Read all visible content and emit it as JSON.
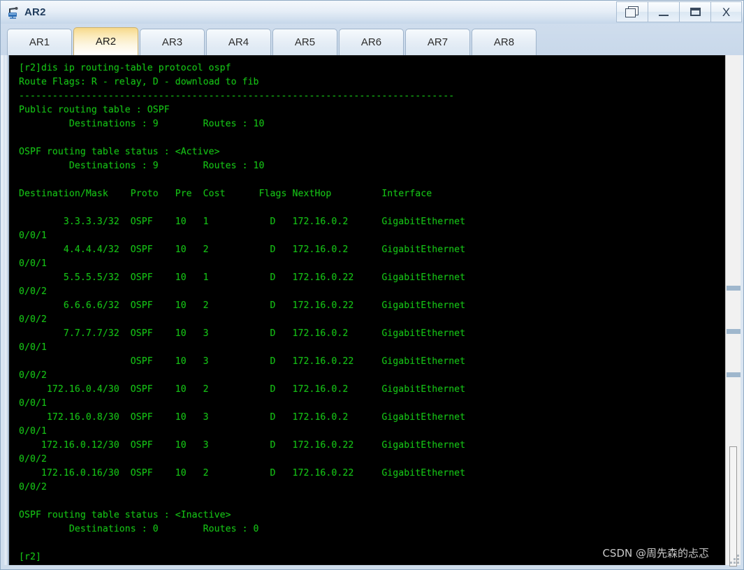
{
  "window": {
    "title": "AR2",
    "icon": "router-icon",
    "controls": [
      {
        "name": "restore-windows-button",
        "label": ""
      },
      {
        "name": "minimize-button",
        "label": ""
      },
      {
        "name": "maximize-button",
        "label": ""
      },
      {
        "name": "close-button",
        "label": "X"
      }
    ]
  },
  "tabs": [
    {
      "label": "AR1",
      "active": false
    },
    {
      "label": "AR2",
      "active": true
    },
    {
      "label": "AR3",
      "active": false
    },
    {
      "label": "AR4",
      "active": false
    },
    {
      "label": "AR5",
      "active": false
    },
    {
      "label": "AR6",
      "active": false
    },
    {
      "label": "AR7",
      "active": false
    },
    {
      "label": "AR8",
      "active": false
    }
  ],
  "terminal": {
    "prompt": "[r2]",
    "command": "dis ip routing-table protocol ospf",
    "colors": {
      "background": "#000000",
      "text": "#15bf15"
    },
    "lines": [
      "[r2]dis ip routing-table protocol ospf",
      "Route Flags: R - relay, D - download to fib",
      "------------------------------------------------------------------------------",
      "Public routing table : OSPF",
      "         Destinations : 9        Routes : 10",
      "",
      "OSPF routing table status : <Active>",
      "         Destinations : 9        Routes : 10",
      "",
      "Destination/Mask    Proto   Pre  Cost      Flags NextHop         Interface",
      "",
      "        3.3.3.3/32  OSPF    10   1           D   172.16.0.2      GigabitEthernet",
      "0/0/1",
      "        4.4.4.4/32  OSPF    10   2           D   172.16.0.2      GigabitEthernet",
      "0/0/1",
      "        5.5.5.5/32  OSPF    10   1           D   172.16.0.22     GigabitEthernet",
      "0/0/2",
      "        6.6.6.6/32  OSPF    10   2           D   172.16.0.22     GigabitEthernet",
      "0/0/2",
      "        7.7.7.7/32  OSPF    10   3           D   172.16.0.2      GigabitEthernet",
      "0/0/1",
      "                    OSPF    10   3           D   172.16.0.22     GigabitEthernet",
      "0/0/2",
      "     172.16.0.4/30  OSPF    10   2           D   172.16.0.2      GigabitEthernet",
      "0/0/1",
      "     172.16.0.8/30  OSPF    10   3           D   172.16.0.2      GigabitEthernet",
      "0/0/1",
      "    172.16.0.12/30  OSPF    10   3           D   172.16.0.22     GigabitEthernet",
      "0/0/2",
      "    172.16.0.16/30  OSPF    10   2           D   172.16.0.22     GigabitEthernet",
      "0/0/2",
      "",
      "OSPF routing table status : <Inactive>",
      "         Destinations : 0        Routes : 0",
      "",
      "[r2]"
    ],
    "route_table": {
      "headers": [
        "Destination/Mask",
        "Proto",
        "Pre",
        "Cost",
        "Flags",
        "NextHop",
        "Interface"
      ],
      "rows": [
        {
          "destination": "3.3.3.3/32",
          "proto": "OSPF",
          "pre": "10",
          "cost": "1",
          "flags": "D",
          "nexthop": "172.16.0.2",
          "interface": "GigabitEthernet0/0/1"
        },
        {
          "destination": "4.4.4.4/32",
          "proto": "OSPF",
          "pre": "10",
          "cost": "2",
          "flags": "D",
          "nexthop": "172.16.0.2",
          "interface": "GigabitEthernet0/0/1"
        },
        {
          "destination": "5.5.5.5/32",
          "proto": "OSPF",
          "pre": "10",
          "cost": "1",
          "flags": "D",
          "nexthop": "172.16.0.22",
          "interface": "GigabitEthernet0/0/2"
        },
        {
          "destination": "6.6.6.6/32",
          "proto": "OSPF",
          "pre": "10",
          "cost": "2",
          "flags": "D",
          "nexthop": "172.16.0.22",
          "interface": "GigabitEthernet0/0/2"
        },
        {
          "destination": "7.7.7.7/32",
          "proto": "OSPF",
          "pre": "10",
          "cost": "3",
          "flags": "D",
          "nexthop": "172.16.0.2",
          "interface": "GigabitEthernet0/0/1"
        },
        {
          "destination": "",
          "proto": "OSPF",
          "pre": "10",
          "cost": "3",
          "flags": "D",
          "nexthop": "172.16.0.22",
          "interface": "GigabitEthernet0/0/2"
        },
        {
          "destination": "172.16.0.4/30",
          "proto": "OSPF",
          "pre": "10",
          "cost": "2",
          "flags": "D",
          "nexthop": "172.16.0.2",
          "interface": "GigabitEthernet0/0/1"
        },
        {
          "destination": "172.16.0.8/30",
          "proto": "OSPF",
          "pre": "10",
          "cost": "3",
          "flags": "D",
          "nexthop": "172.16.0.2",
          "interface": "GigabitEthernet0/0/1"
        },
        {
          "destination": "172.16.0.12/30",
          "proto": "OSPF",
          "pre": "10",
          "cost": "3",
          "flags": "D",
          "nexthop": "172.16.0.22",
          "interface": "GigabitEthernet0/0/2"
        },
        {
          "destination": "172.16.0.16/30",
          "proto": "OSPF",
          "pre": "10",
          "cost": "2",
          "flags": "D",
          "nexthop": "172.16.0.22",
          "interface": "GigabitEthernet0/0/2"
        }
      ]
    },
    "summary": {
      "public_table": "Public routing table : OSPF",
      "public_destinations": "9",
      "public_routes": "10",
      "active_status": "OSPF routing table status : <Active>",
      "active_destinations": "9",
      "active_routes": "10",
      "inactive_status": "OSPF routing table status : <Inactive>",
      "inactive_destinations": "0",
      "inactive_routes": "0",
      "route_flags": "Route Flags: R - relay, D - download to fib"
    }
  },
  "watermark": {
    "text": "CSDN @周先森的忐忑"
  }
}
